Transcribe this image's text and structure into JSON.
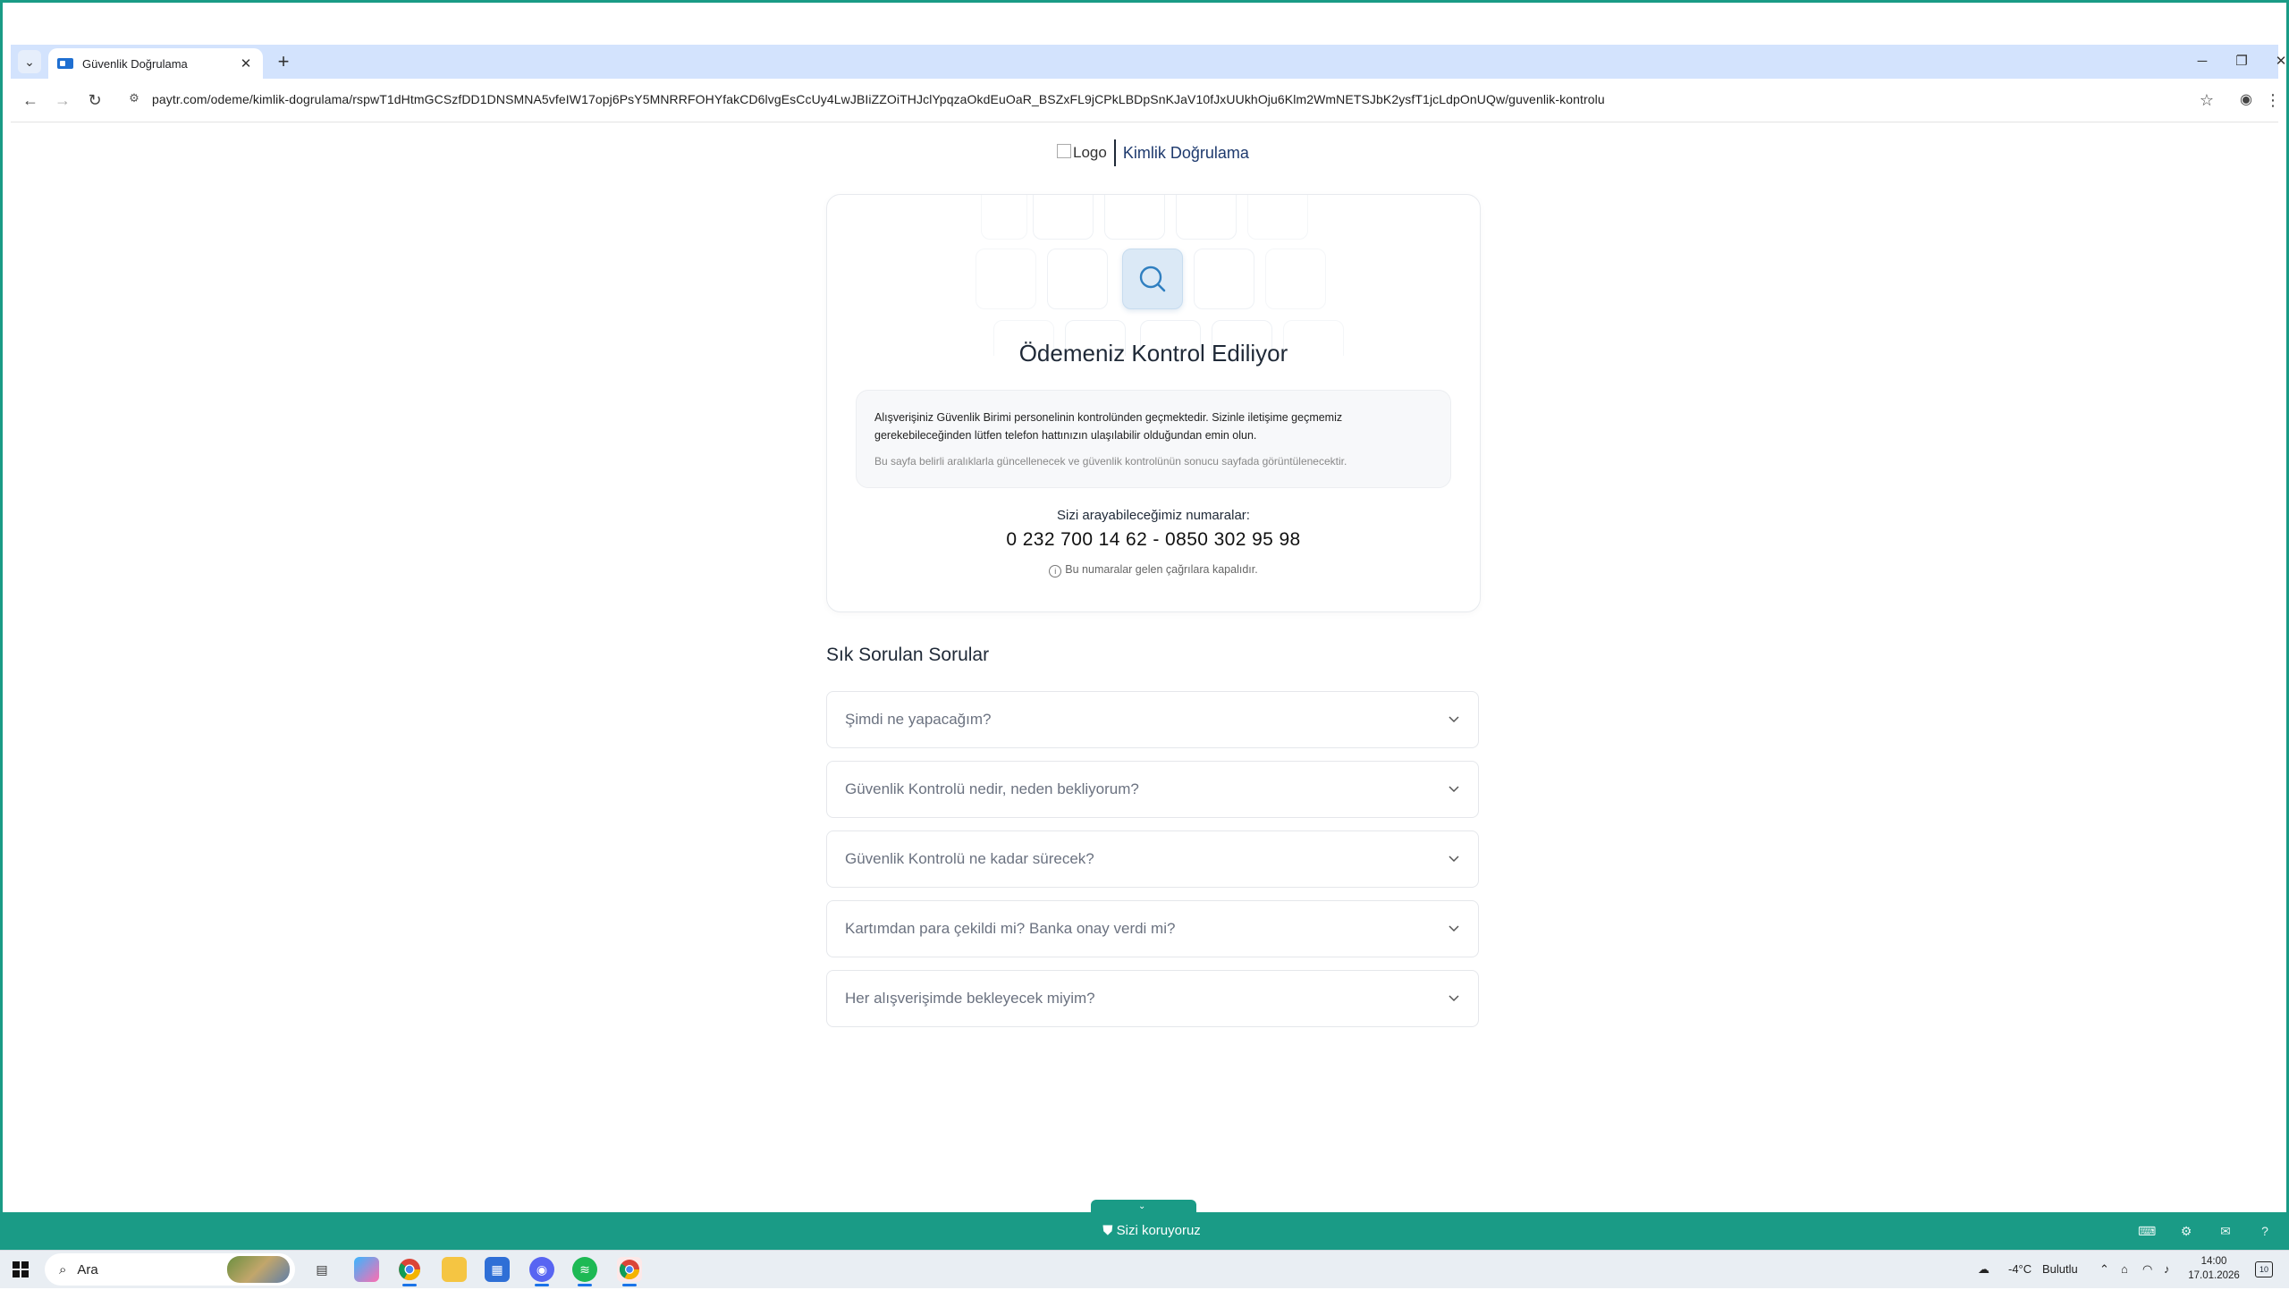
{
  "browser": {
    "tab_title": "Güvenlik Doğrulama",
    "tab_close": "✕",
    "new_tab": "+",
    "url": "paytr.com/odeme/kimlik-dogrulama/rspwT1dHtmGCSzfDD1DNSMNA5vfeIW17opj6PsY5MNRRFOHYfakCD6lvgEsCcUy4LwJBIiZZOiTHJclYpqzaOkdEuOaR_BSZxFL9jCPkLBDpSnKJaV10fJxUUkhOju6Klm2WmNETSJbK2ysfT1jcLdpOnUQw/guvenlik-kontrolu"
  },
  "header": {
    "logo_alt": "Logo",
    "title": "Kimlik Doğrulama"
  },
  "card": {
    "title": "Ödemeniz Kontrol Ediliyor",
    "notice_main": "Alışverişiniz Güvenlik Birimi personelinin kontrolünden geçmektedir. Sizinle iletişime geçmemiz gerekebileceğinden lütfen telefon hattınızın ulaşılabilir olduğundan emin olun.",
    "notice_sub": "Bu sayfa belirli aralıklarla güncellenecek ve güvenlik kontrolünün sonucu sayfada görüntülenecektir.",
    "call_label": "Sizi arayabileceğimiz numaralar:",
    "call_numbers": "0 232 700 14 62 - 0850 302 95 98",
    "call_note": "Bu numaralar gelen çağrılara kapalıdır."
  },
  "faq": {
    "title": "Sık Sorulan Sorular",
    "items": [
      {
        "q": "Şimdi ne yapacağım?"
      },
      {
        "q": "Güvenlik Kontrolü nedir, neden bekliyorum?"
      },
      {
        "q": "Güvenlik Kontrolü ne kadar sürecek?"
      },
      {
        "q": "Kartımdan para çekildi mi? Banka onay verdi mi?"
      },
      {
        "q": "Her alışverişimde bekleyecek miyim?"
      }
    ]
  },
  "footer": {
    "text": "Sizi koruyoruz"
  },
  "taskbar": {
    "search_label": "Ara",
    "weather": "-4°C",
    "weather_desc": "Bulutlu",
    "time": "14:00",
    "date": "17.01.2026",
    "notif_count": "10"
  },
  "colors": {
    "accent": "#1a9b86",
    "tab_strip": "#d3e3fd",
    "search_tile": "#dbe9f6",
    "heading_blue": "#1e3a6e"
  }
}
